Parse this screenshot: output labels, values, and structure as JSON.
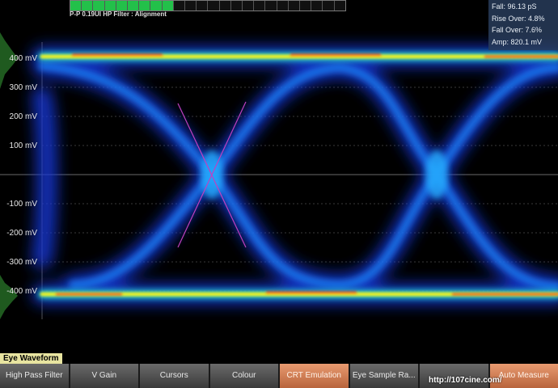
{
  "header": {
    "status_text": "P-P 0.19UI  HP Filter : Alignment"
  },
  "measurements": {
    "fall": "Fall: 96.13 pS",
    "rise_over": "Rise Over: 4.8%",
    "fall_over": "Fall Over: 7.6%",
    "amp": "Amp: 820.1 mV"
  },
  "y_axis": {
    "labels": [
      "400 mV",
      "300 mV",
      "200 mV",
      "100 mV",
      "-100 mV",
      "-200 mV",
      "-300 mV",
      "-400 mV"
    ]
  },
  "waveform_label": "Eye Waveform",
  "softkeys": [
    {
      "label": "High Pass Filter"
    },
    {
      "label": "V Gain"
    },
    {
      "label": "Cursors"
    },
    {
      "label": "Colour"
    },
    {
      "label": "CRT Emulation"
    },
    {
      "label": "Eye Sample Ra..."
    },
    {
      "label": ""
    },
    {
      "label": "Auto Measure"
    }
  ],
  "watermark": "http://107cine.com/",
  "colors": {
    "trace_low": "#1a3cff",
    "trace_mid": "#20d0ff",
    "trace_hot": "#ff3010",
    "crosshair": "#c040c0",
    "active_key": "#d07a4c"
  }
}
